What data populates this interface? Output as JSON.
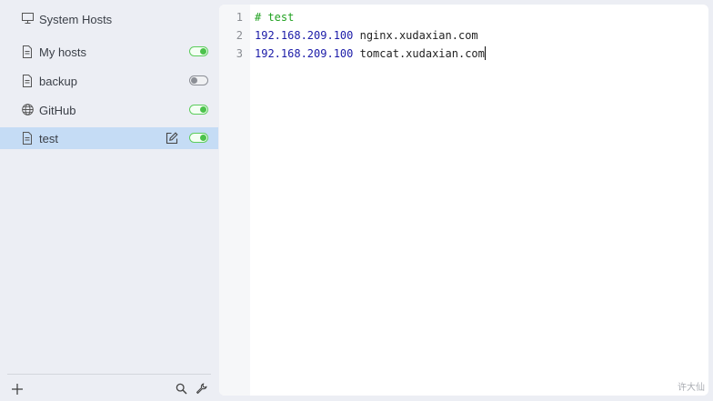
{
  "sidebar": {
    "system_hosts": {
      "label": "System Hosts",
      "icon": "monitor-icon"
    },
    "items": [
      {
        "label": "My hosts",
        "icon": "file-icon",
        "enabled": true,
        "active": false
      },
      {
        "label": "backup",
        "icon": "file-icon",
        "enabled": false,
        "active": false
      },
      {
        "label": "GitHub",
        "icon": "globe-icon",
        "enabled": true,
        "active": false
      },
      {
        "label": "test",
        "icon": "file-icon",
        "enabled": true,
        "active": true,
        "editable": true
      }
    ],
    "bottom": {
      "add_icon": "plus-icon",
      "search_icon": "search-icon",
      "settings_icon": "wrench-icon"
    }
  },
  "editor": {
    "line_numbers": [
      "1",
      "2",
      "3"
    ],
    "lines": [
      {
        "comment": "# test"
      },
      {
        "ip": "192.168.209.100",
        "host": "nginx.xudaxian.com"
      },
      {
        "ip": "192.168.209.100",
        "host": "tomcat.xudaxian.com"
      }
    ]
  },
  "watermark": "许大仙",
  "colors": {
    "active_bg": "#c5dcf5",
    "toggle_on": "#4cc24c",
    "comment": "#22a222",
    "ip": "#1b1ba8"
  }
}
